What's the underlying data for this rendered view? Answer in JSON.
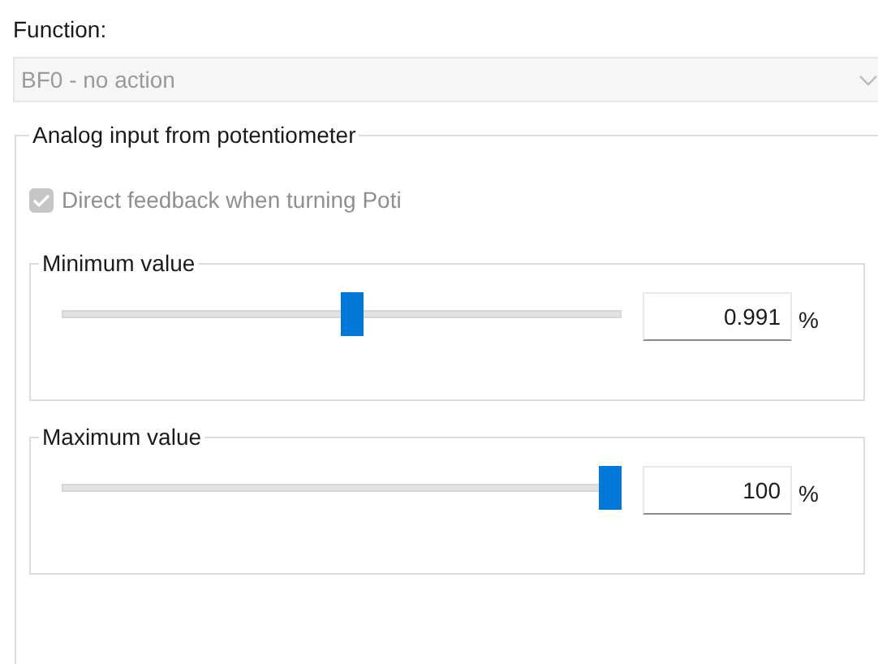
{
  "function": {
    "label": "Function:",
    "value": "BF0 - no action",
    "disabled": true
  },
  "analog_group": {
    "title": "Analog input from potentiometer",
    "feedback_checkbox": {
      "label": "Direct feedback when turning Poti",
      "checked": true,
      "disabled": true
    },
    "sliders": [
      {
        "title": "Minimum value",
        "level": 0.52,
        "value": "0.991",
        "unit": "%"
      },
      {
        "title": "Maximum value",
        "level": 1.0,
        "value": "100",
        "unit": "%"
      }
    ]
  }
}
